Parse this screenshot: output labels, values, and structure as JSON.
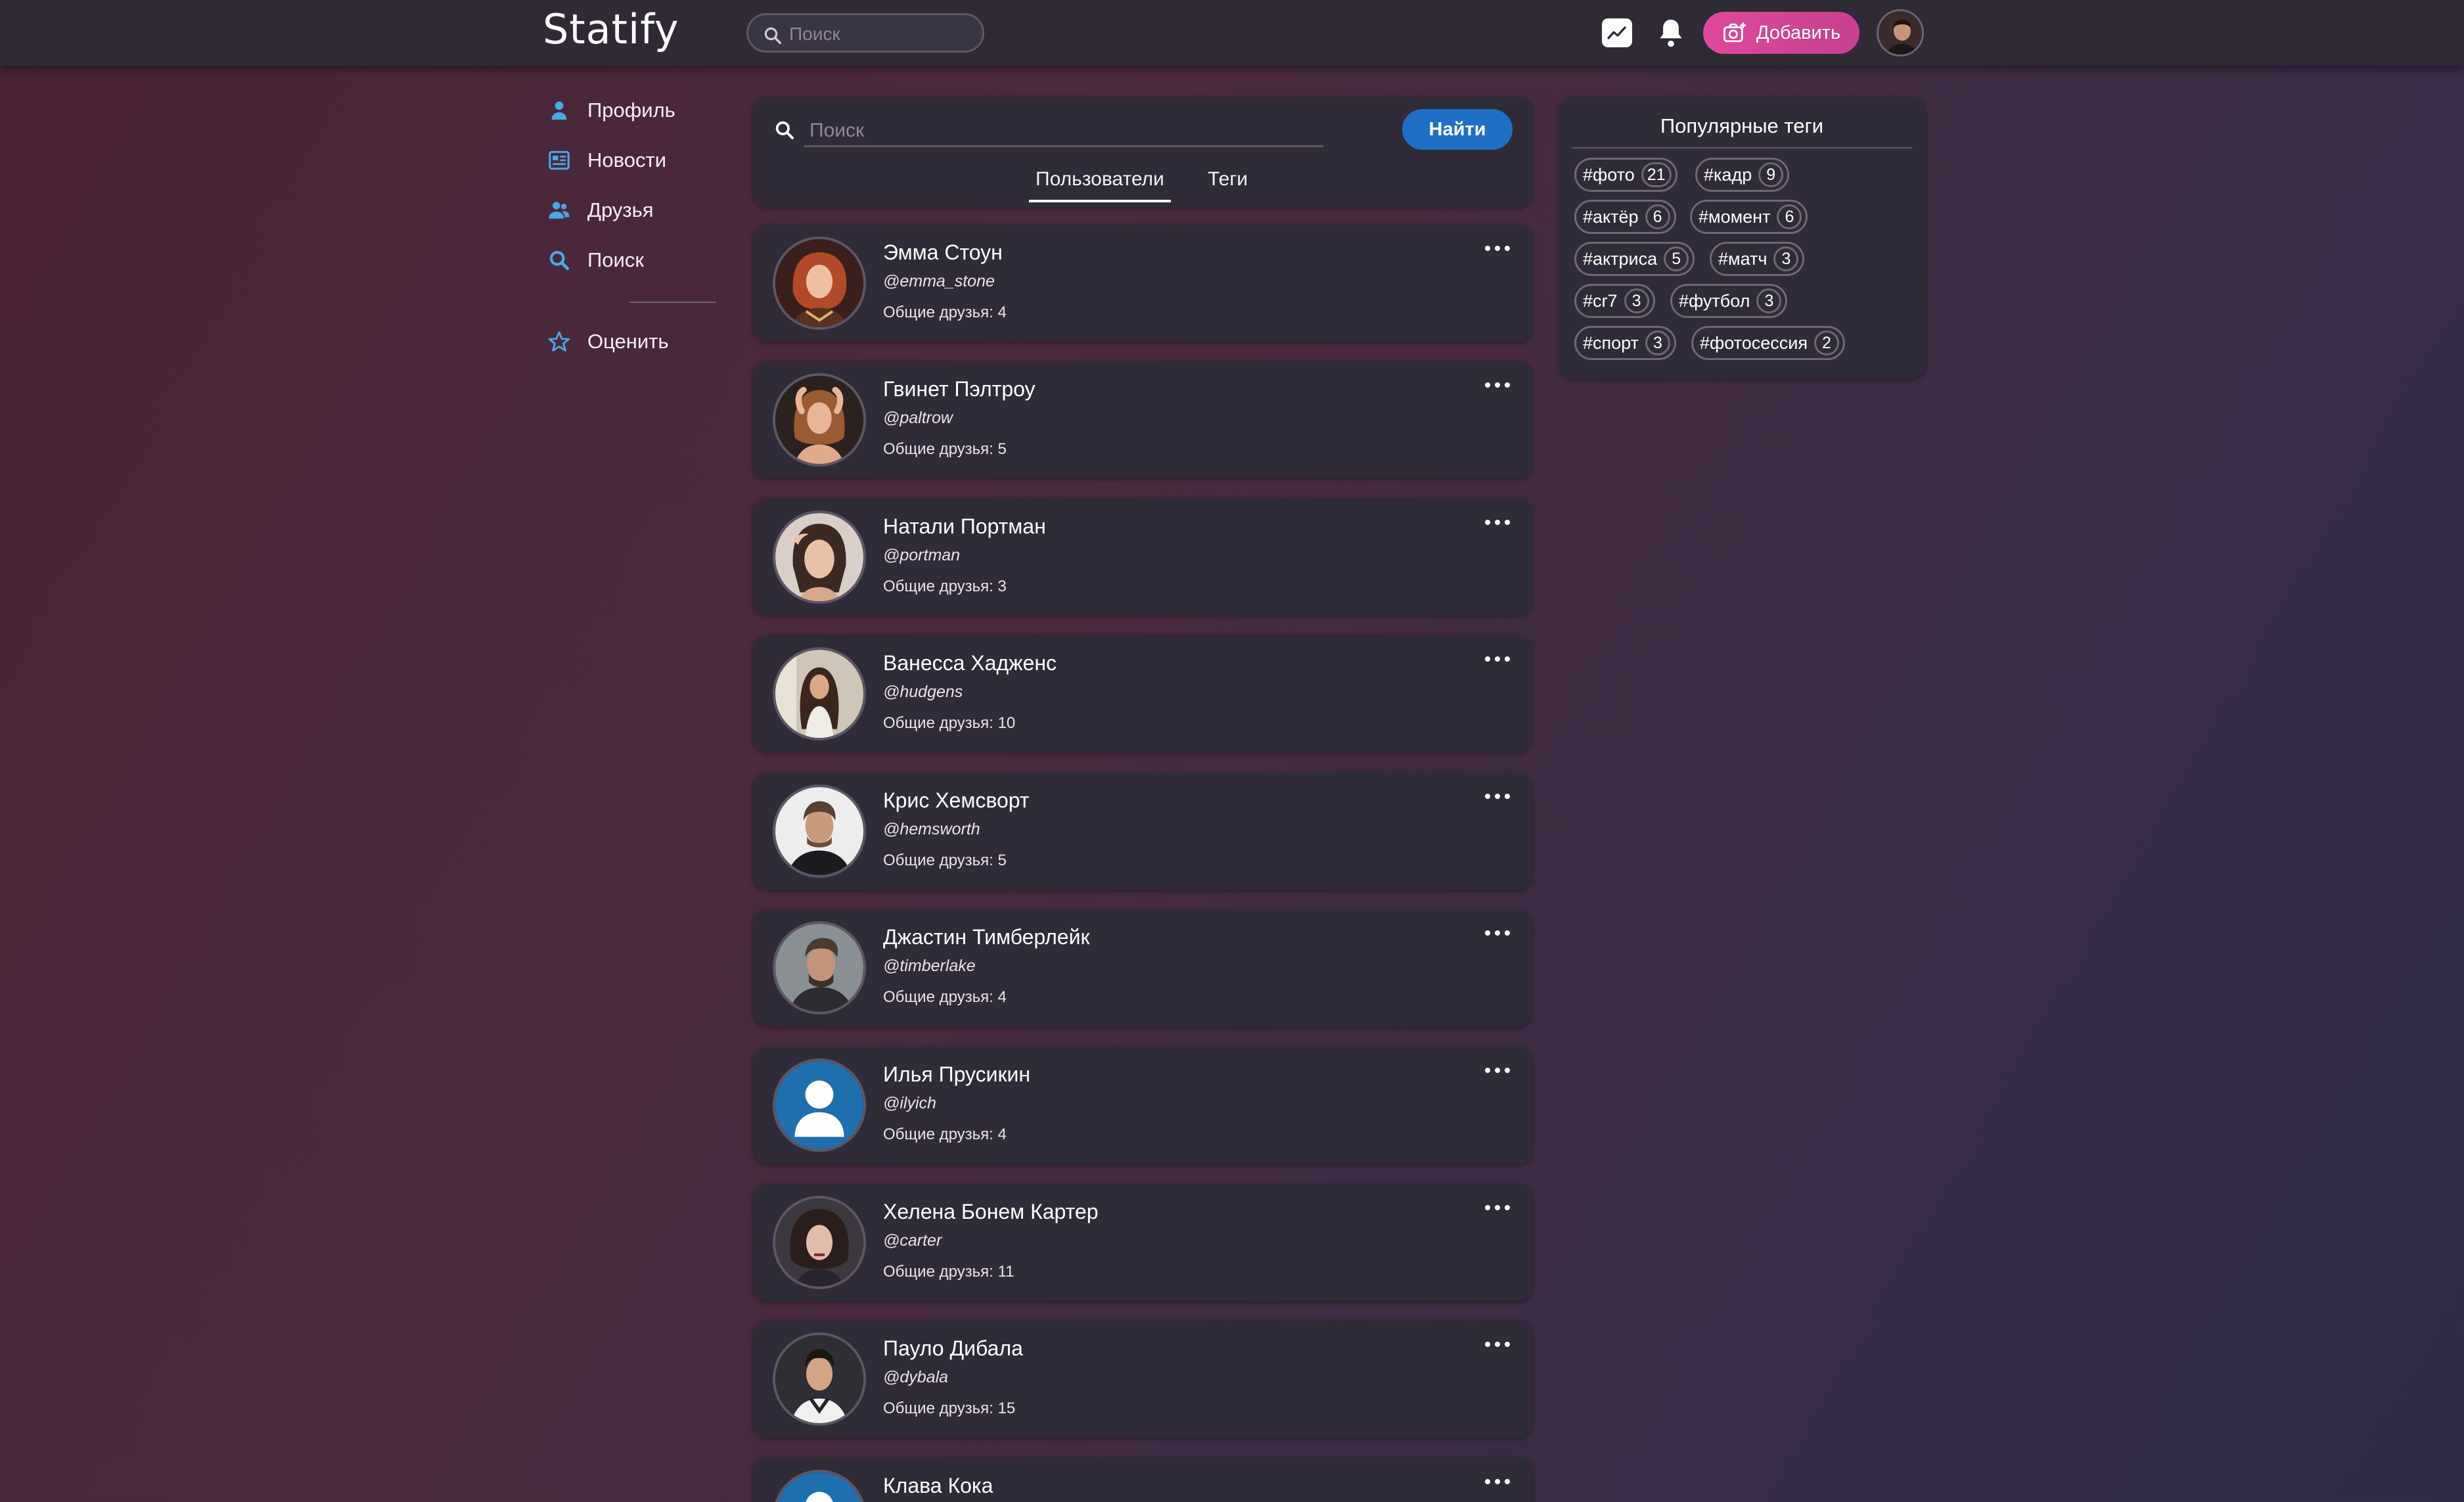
{
  "app": {
    "logo": "Statify"
  },
  "topbar": {
    "search_placeholder": "Поиск",
    "add_label": "Добавить"
  },
  "sidebar": {
    "items": [
      {
        "label": "Профиль",
        "icon": "user-icon"
      },
      {
        "label": "Новости",
        "icon": "newspaper-icon"
      },
      {
        "label": "Друзья",
        "icon": "friends-icon"
      },
      {
        "label": "Поиск",
        "icon": "search-icon"
      },
      {
        "label": "Оценить",
        "icon": "star-icon"
      }
    ]
  },
  "search": {
    "placeholder": "Поиск",
    "find_label": "Найти",
    "tabs": [
      {
        "label": "Пользователи",
        "active": true
      },
      {
        "label": "Теги",
        "active": false
      }
    ]
  },
  "users": [
    {
      "name": "Эмма Стоун",
      "handle": "@emma_stone",
      "mutual": "Общие друзья: 4"
    },
    {
      "name": "Гвинет Пэлтроу",
      "handle": "@paltrow",
      "mutual": "Общие друзья: 5"
    },
    {
      "name": "Натали Портман",
      "handle": "@portman",
      "mutual": "Общие друзья: 3"
    },
    {
      "name": "Ванесса Хадженс",
      "handle": "@hudgens",
      "mutual": "Общие друзья: 10"
    },
    {
      "name": "Крис Хемсворт",
      "handle": "@hemsworth",
      "mutual": "Общие друзья: 5"
    },
    {
      "name": "Джастин Тимберлейк",
      "handle": "@timberlake",
      "mutual": "Общие друзья: 4"
    },
    {
      "name": "Илья Прусикин",
      "handle": "@ilyich",
      "mutual": "Общие друзья: 4"
    },
    {
      "name": "Хелена Бонем Картер",
      "handle": "@carter",
      "mutual": "Общие друзья: 11"
    },
    {
      "name": "Пауло Дибала",
      "handle": "@dybala",
      "mutual": "Общие друзья: 15"
    },
    {
      "name": "Клава Кока",
      "handle": "",
      "mutual": ""
    }
  ],
  "tags": {
    "title": "Популярные теги",
    "items": [
      {
        "tag": "#фото",
        "count": "21"
      },
      {
        "tag": "#кадр",
        "count": "9"
      },
      {
        "tag": "#актёр",
        "count": "6"
      },
      {
        "tag": "#момент",
        "count": "6"
      },
      {
        "tag": "#актриса",
        "count": "5"
      },
      {
        "tag": "#матч",
        "count": "3"
      },
      {
        "tag": "#cr7",
        "count": "3"
      },
      {
        "tag": "#футбол",
        "count": "3"
      },
      {
        "tag": "#спорт",
        "count": "3"
      },
      {
        "tag": "#фотосессия",
        "count": "2"
      }
    ]
  },
  "colors": {
    "accent_blue": "#1f6fc4",
    "add_pink": "#d8469a",
    "panel": "#302b38",
    "topbar": "#2f2a36"
  }
}
